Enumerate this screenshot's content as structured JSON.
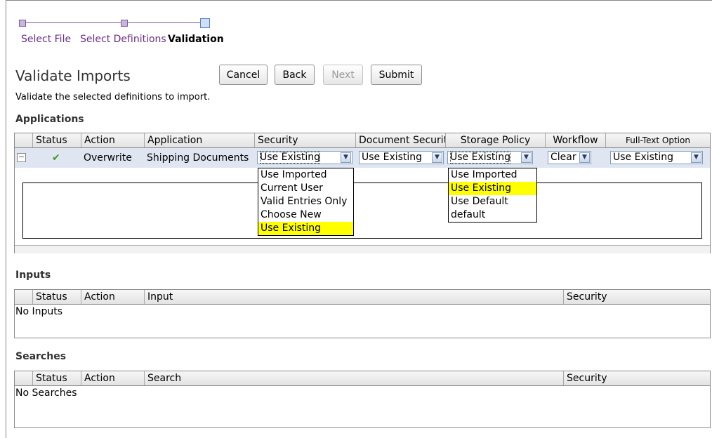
{
  "train": {
    "steps": [
      {
        "label": "Select File",
        "state": "visited"
      },
      {
        "label": "Select Definitions",
        "state": "visited"
      },
      {
        "label": "Validation",
        "state": "current"
      }
    ]
  },
  "page": {
    "title": "Validate Imports",
    "subtitle": "Validate the selected definitions to import."
  },
  "buttons": {
    "cancel": "Cancel",
    "back": "Back",
    "next": "Next",
    "submit": "Submit"
  },
  "applications": {
    "section_title": "Applications",
    "columns": [
      "Status",
      "Action",
      "Application",
      "Security",
      "Document Securit",
      "Storage Policy",
      "Workflow",
      "Full-Text Option"
    ],
    "row": {
      "expander": "−",
      "status": "✔",
      "action": "Overwrite",
      "application": "Shipping Documents",
      "security": "Use Existing",
      "document_security": "Use Existing",
      "storage_policy": "Use Existing",
      "workflow": "Clear",
      "full_text": "Use Existing"
    },
    "security_options": [
      "Use Imported",
      "Current User",
      "Valid Entries Only",
      "Choose New",
      "Use Existing"
    ],
    "storage_policy_options": [
      "Use Imported",
      "Use Existing",
      "Use Default",
      "default"
    ]
  },
  "inputs": {
    "section_title": "Inputs",
    "columns": [
      "Status",
      "Action",
      "Input",
      "Security"
    ],
    "empty_text": "No Inputs"
  },
  "searches": {
    "section_title": "Searches",
    "columns": [
      "Status",
      "Action",
      "Search",
      "Security"
    ],
    "empty_text": "No Searches"
  },
  "colors": {
    "link": "#6a2d86",
    "row_background": "#dfe6f1",
    "highlight": "#ffff00",
    "status_ok": "#3a9d2a"
  },
  "icons": {
    "expander": "collapse-minus-icon",
    "status": "checkmark-icon",
    "dropdown": "chevron-down-icon"
  }
}
